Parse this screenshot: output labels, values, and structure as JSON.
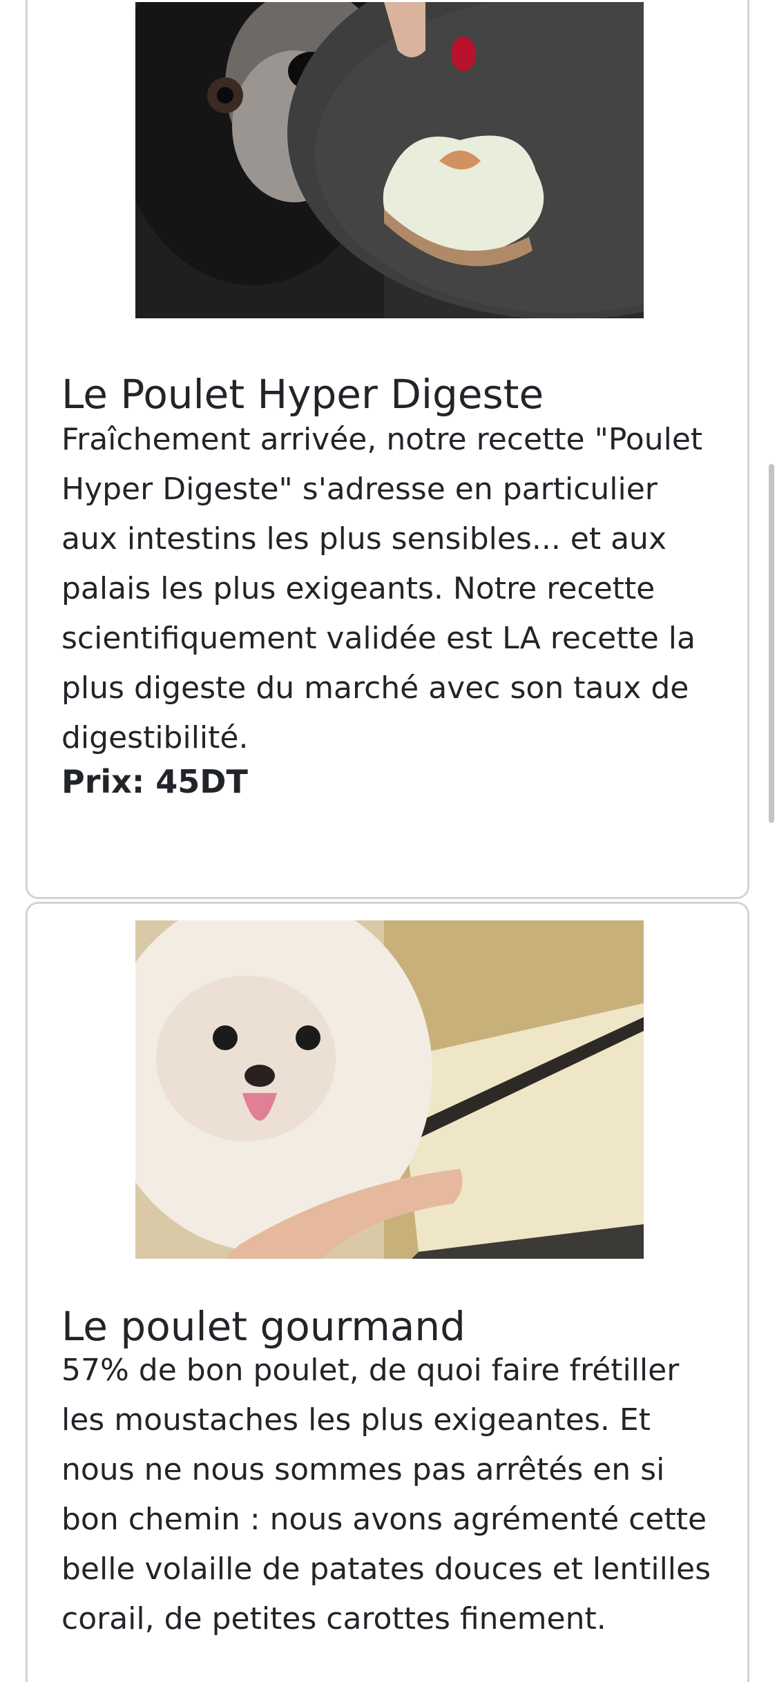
{
  "products": [
    {
      "image_alt": "dog-with-bone-treat-bowl",
      "title": "Le Poulet Hyper Digeste",
      "description": "Fraîchement arrivée, notre recette \"Poulet Hyper Digeste\" s'adresse en particulier aux intestins les plus sensibles... et aux palais les plus exigeants. Notre recette scientifiquement validée est LA recette la plus digeste du marché avec son taux de digestibilité.",
      "price": "Prix: 45DT"
    },
    {
      "image_alt": "pomeranian-with-menu",
      "title": "Le poulet gourmand",
      "description": "57% de bon poulet, de quoi faire frétiller les moustaches les plus exigeantes. Et nous ne nous sommes pas arrêtés en si bon chemin : nous avons agrémenté cette belle volaille de patates douces et lentilles corail, de petites carottes finement."
    }
  ]
}
